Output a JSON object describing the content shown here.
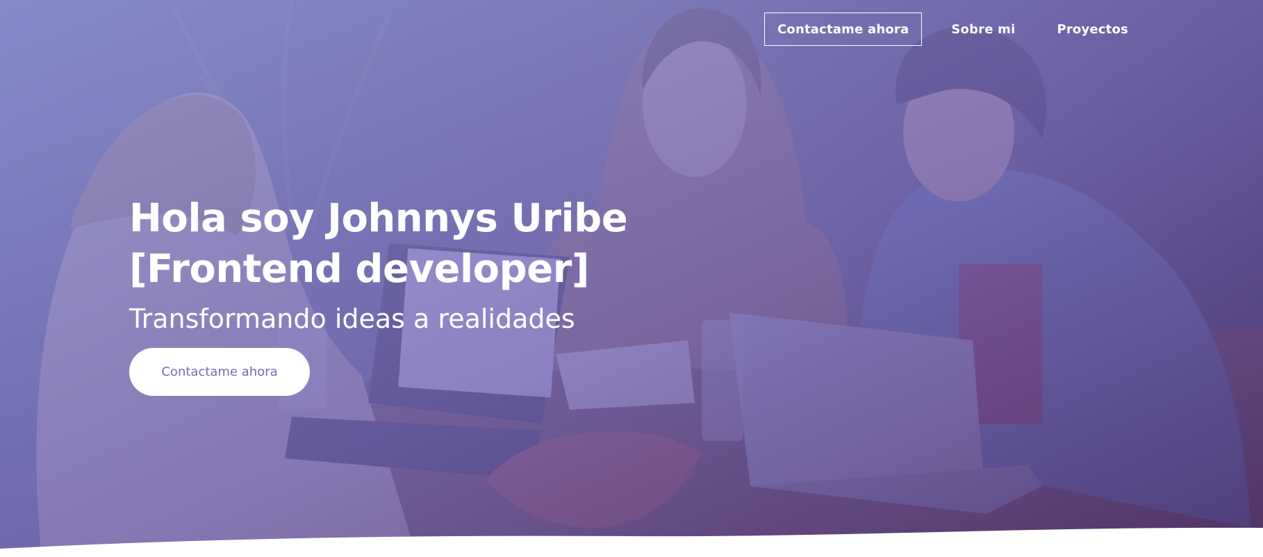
{
  "nav": {
    "items": [
      {
        "label": "Contactame ahora"
      },
      {
        "label": "Sobre mi"
      },
      {
        "label": "Proyectos"
      }
    ]
  },
  "hero": {
    "title": "Hola soy Johnnys Uribe [Frontend developer]",
    "subtitle": "Transformando ideas a realidades",
    "cta_label": "Contactame ahora",
    "photo_description_icon": "photo-icon"
  },
  "colors": {
    "overlay_start": "#8a8fd6",
    "overlay_end": "#4b2f6f",
    "cta_text": "#6e6db8",
    "nav_text": "#ffffff",
    "page_bg": "#ffffff"
  }
}
